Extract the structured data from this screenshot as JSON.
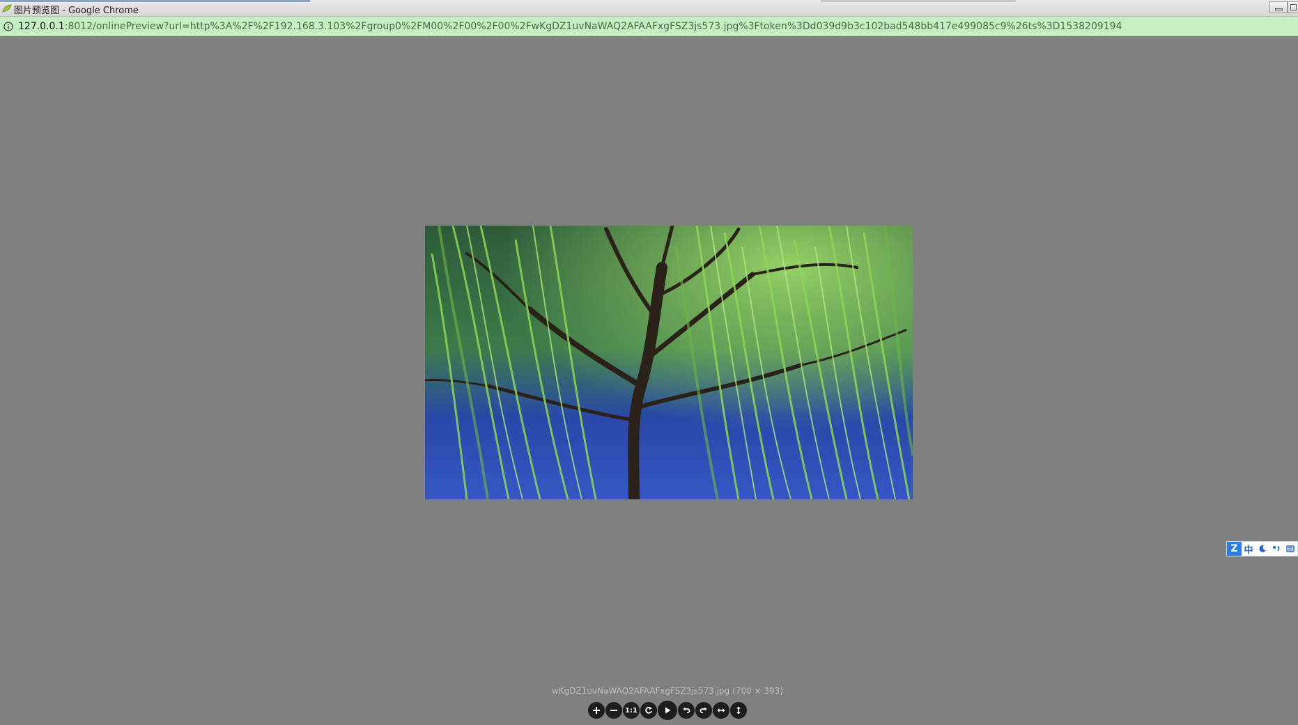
{
  "window": {
    "title": "图片预览图 - Google Chrome"
  },
  "address_bar": {
    "url_host": "127.0.0.1",
    "url_rest": ":8012/onlinePreview?url=http%3A%2F%2F192.168.3.103%2Fgroup0%2FM00%2F00%2F00%2FwKgDZ1uvNaWAQ2AFAAFxgFSZ3js573.jpg%3Ftoken%3Dd039d9b3c102bad548bb417e499085c9%26ts%3D1538209194"
  },
  "viewer": {
    "image_description_icon": "photo-icon",
    "file_name": "wKgDZ1uvNaWAQ2AFAAFxgFSZ3js573.jpg",
    "dimensions": "(700 × 393)",
    "toolbar": [
      {
        "name": "zoom-in-button",
        "icon": "plus-icon"
      },
      {
        "name": "zoom-out-button",
        "icon": "minus-icon"
      },
      {
        "name": "one-to-one-button",
        "icon": "one-to-one-icon",
        "label": "1:1"
      },
      {
        "name": "reset-button",
        "icon": "refresh-icon"
      },
      {
        "name": "play-button",
        "icon": "play-icon"
      },
      {
        "name": "rotate-left-button",
        "icon": "rotate-left-icon"
      },
      {
        "name": "rotate-right-button",
        "icon": "rotate-right-icon"
      },
      {
        "name": "flip-horizontal-button",
        "icon": "flip-horizontal-icon"
      },
      {
        "name": "flip-vertical-button",
        "icon": "flip-vertical-icon"
      }
    ]
  },
  "ime": {
    "logo": "Z",
    "mode": "中",
    "items": [
      "moon-icon",
      "punctuation-icon",
      "keyboard-icon"
    ]
  },
  "colors": {
    "background": "#808080",
    "address_bar": "#c5efc3",
    "toolbar_button": "#1d1d1d",
    "ime_accent": "#2d7de0"
  }
}
